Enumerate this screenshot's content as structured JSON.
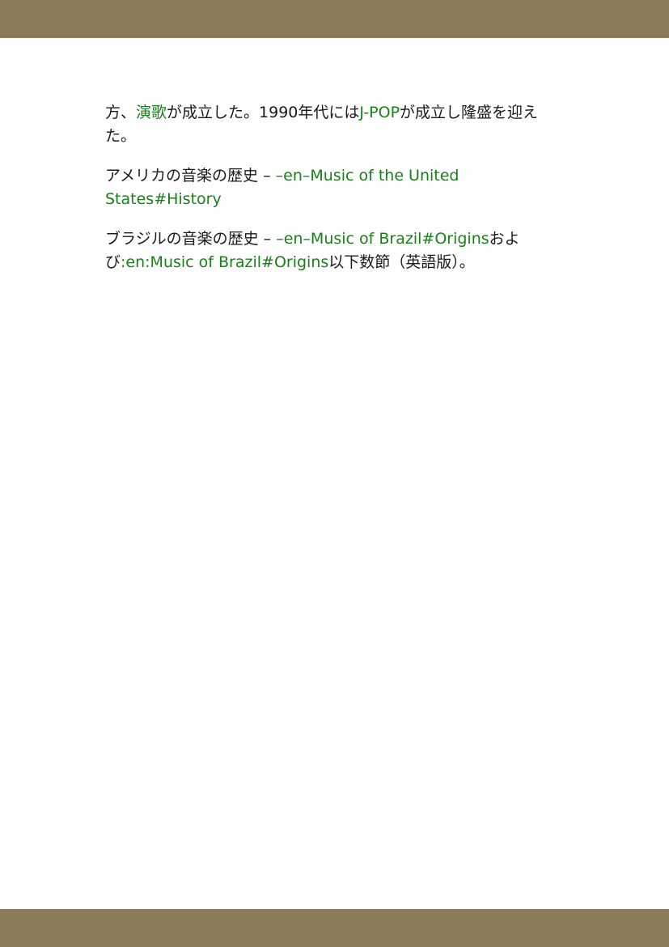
{
  "colors": {
    "band": "#8b7d5a",
    "link": "#1a7f1a",
    "text": "#1a1a1a"
  },
  "paragraphs": [
    {
      "segments": [
        {
          "text": "方、",
          "link": false
        },
        {
          "text": "演歌",
          "link": true
        },
        {
          "text": "が成立した。1990年代には",
          "link": false
        },
        {
          "text": "J-POP",
          "link": true
        },
        {
          "text": "が成立し隆盛を迎えた。",
          "link": false
        }
      ]
    },
    {
      "segments": [
        {
          "text": "アメリカの音楽の歴史 – ",
          "link": false
        },
        {
          "text": "–en–Music of the United States#History",
          "link": true
        }
      ]
    },
    {
      "segments": [
        {
          "text": "ブラジルの音楽の歴史 – ",
          "link": false
        },
        {
          "text": "–en–Music of Brazil#Origins",
          "link": true
        },
        {
          "text": "および",
          "link": false
        },
        {
          "text": ":en:Music of Brazil#Origins",
          "link": true
        },
        {
          "text": "以下数節（英語版）。",
          "link": false
        }
      ]
    }
  ]
}
